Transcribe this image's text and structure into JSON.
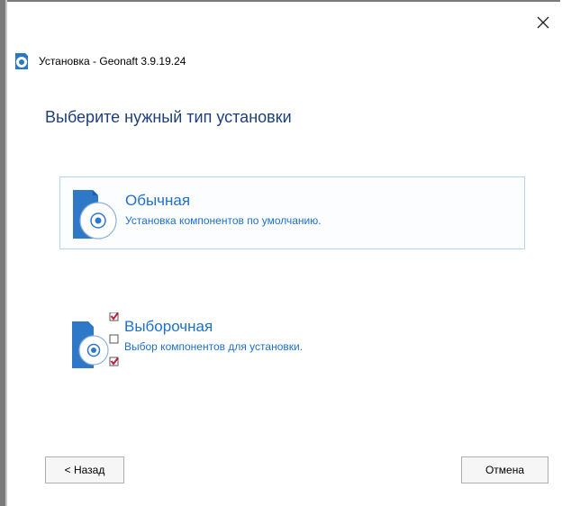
{
  "window": {
    "title": "Установка - Geonaft 3.9.19.24"
  },
  "heading": "Выберите нужный тип установки",
  "options": [
    {
      "title": "Обычная",
      "description": "Установка компонентов по умолчанию.",
      "icon": "disc-box-icon"
    },
    {
      "title": "Выборочная",
      "description": "Выбор компонентов для установки.",
      "icon": "disc-box-checklist-icon"
    }
  ],
  "buttons": {
    "back": "< Назад",
    "cancel": "Отмена"
  },
  "colors": {
    "heading": "#1f3f7a",
    "accent": "#1e6fd0",
    "check": "#c21a3a"
  }
}
